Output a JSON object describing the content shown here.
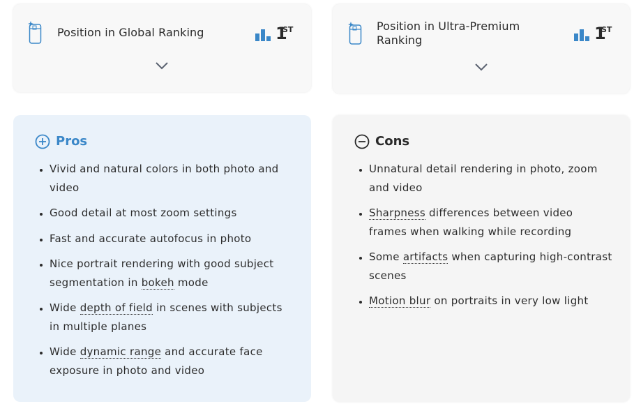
{
  "rankings": [
    {
      "title": "Position in Global Ranking",
      "value": "1",
      "suffix": "ST"
    },
    {
      "title": "Position in Ultra-Premium Ranking",
      "value": "1",
      "suffix": "ST"
    }
  ],
  "pros": {
    "title": "Pros",
    "items": [
      {
        "pre": "Vivid and natural colors in both photo and video",
        "term": "",
        "post": ""
      },
      {
        "pre": "Good detail at most zoom settings",
        "term": "",
        "post": ""
      },
      {
        "pre": "Fast and accurate autofocus in photo",
        "term": "",
        "post": ""
      },
      {
        "pre": "Nice portrait rendering with good subject segmentation in ",
        "term": "bokeh",
        "post": " mode"
      },
      {
        "pre": "Wide ",
        "term": "depth of field",
        "post": " in scenes with subjects in multiple planes"
      },
      {
        "pre": "Wide ",
        "term": "dynamic range",
        "post": " and accurate face exposure in photo and video"
      }
    ]
  },
  "cons": {
    "title": "Cons",
    "items": [
      {
        "pre": "Unnatural detail rendering in photo, zoom and video",
        "term": "",
        "post": ""
      },
      {
        "pre": "",
        "term": "Sharpness",
        "post": " differences between video frames when walking while recording"
      },
      {
        "pre": "Some ",
        "term": "artifacts",
        "post": " when capturing high-contrast scenes"
      },
      {
        "pre": "",
        "term": "Motion blur",
        "post": " on portraits in very low light"
      }
    ]
  },
  "colors": {
    "accent": "#3a87c8",
    "pros_bg": "#eaf2fa",
    "cons_bg": "#f5f5f5",
    "card_bg": "#f8f8f8"
  },
  "icons": {
    "phone": "phone-sparkle-icon",
    "ranking": "bar-chart-icon",
    "expand": "chevron-down-icon",
    "pros": "plus-circle-icon",
    "cons": "minus-circle-icon"
  }
}
